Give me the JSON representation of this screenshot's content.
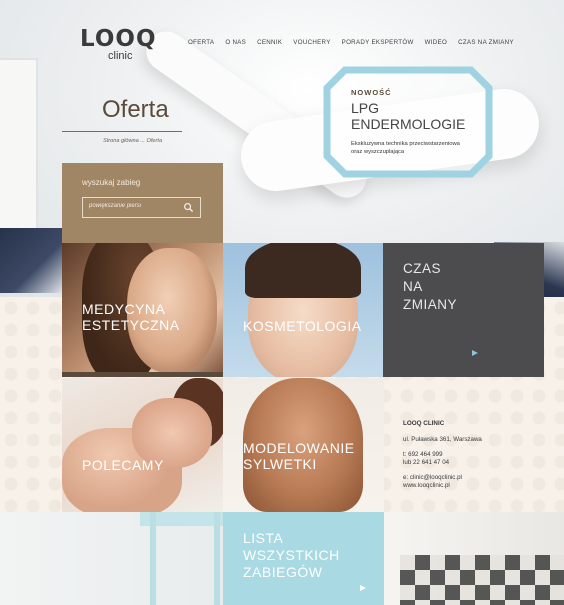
{
  "logo": {
    "main": "LOOQ",
    "sub": "clinic"
  },
  "nav": {
    "items": [
      "OFERTA",
      "O NAS",
      "CENNIK",
      "VOUCHERY",
      "PORADY EKSPERTÓW",
      "WIDEO",
      "CZAS NA ZMIANY"
    ]
  },
  "page": {
    "title": "Oferta",
    "breadcrumb": "Strona główna  ...  Oferta"
  },
  "promo": {
    "label": "NOWOŚĆ",
    "title_line1": "LPG",
    "title_line2": "ENDERMOLOGIE",
    "desc_line1": "Ekskluzywna technika przeciwstarzeniowa",
    "desc_line2": "oraz wyszczuplająca",
    "frame_color": "#9fd3e2"
  },
  "search": {
    "label": "wyszukaj zabieg",
    "placeholder": "powiększanie piersi",
    "icon": "search-icon"
  },
  "tiles": {
    "medycyna": {
      "line1": "MEDYCYNA",
      "line2": "ESTETYCZNA"
    },
    "kosmetologia": {
      "line1": "KOSMETOLOGIA"
    },
    "czas": {
      "line1": "CZAS",
      "line2": "NA",
      "line3": "ZMIANY"
    },
    "polecamy": {
      "line1": "POLECAMY"
    },
    "modelowanie": {
      "line1": "MODELOWANIE",
      "line2": "SYLWETKI"
    },
    "lista": {
      "line1": "LISTA",
      "line2": "WSZYSTKICH",
      "line3": "ZABIEGÓW"
    }
  },
  "contact": {
    "heading": "LOOQ CLINIC",
    "address": "ul. Puławska 361, Warszawa",
    "phone": "t: 692 464 999",
    "phone2": "lub 22 641 47 04",
    "email": "e: clinic@looqclinic.pl",
    "web": "www.looqclinic.pl"
  },
  "colors": {
    "brown": "#a08665",
    "dark_grey": "#4c4c4e",
    "light_blue": "#a9d9e3",
    "accent_blue": "#9fd3e2"
  }
}
